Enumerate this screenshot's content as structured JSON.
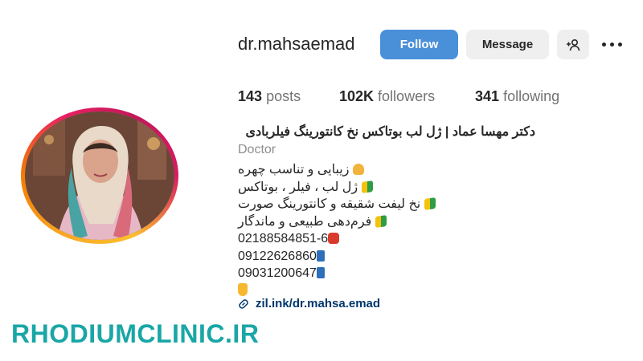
{
  "profile": {
    "username": "dr.mahsaemad",
    "buttons": {
      "follow": "Follow",
      "message": "Message"
    },
    "stats": {
      "posts_value": "143",
      "posts_label": "posts",
      "followers_value": "102K",
      "followers_label": "followers",
      "following_value": "341",
      "following_label": "following"
    },
    "full_name": "دکتر مهسا عماد | ژل لب بوتاکس نخ کانتورینگ فیلربادی",
    "category": "Doctor",
    "bio": [
      "زیبایی و تناسب چهره",
      "ژل لب ، فیلر ، بوتاکس",
      "نخ لیفت شقیقه و کانتورینگ صورت",
      "فرم‌دهی طبیعی و ماندگار",
      "02188584851-6",
      "09122626860",
      "09031200647"
    ],
    "link": "zil.ink/dr.mahsa.emad"
  },
  "watermark": "RHODIUMCLINIC.IR",
  "icons": [
    "add-user-icon",
    "more-options-icon",
    "link-icon"
  ],
  "colors": {
    "follow_button": "#4a90d9",
    "link": "#00376b",
    "watermark": "#1aa6a6"
  }
}
